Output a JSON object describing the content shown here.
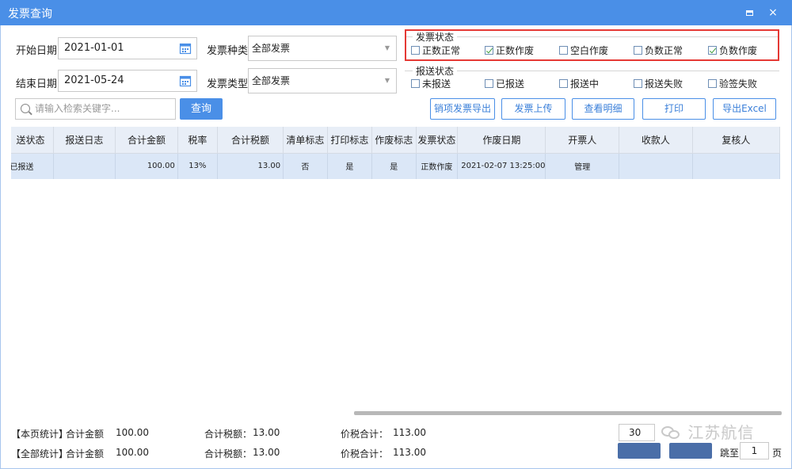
{
  "window": {
    "title": "发票查询",
    "minimize_label": "",
    "close_label": "×"
  },
  "filters": {
    "start_date_label": "开始日期",
    "start_date_value": "2021-01-01",
    "end_date_label": "结束日期",
    "end_date_value": "2021-05-24",
    "invoice_kind_label": "发票种类",
    "invoice_kind_value": "全部发票",
    "invoice_type_label": "发票类型",
    "invoice_type_value": "全部发票"
  },
  "invoice_status": {
    "title": "发票状态",
    "options": [
      {
        "label": "正数正常",
        "checked": false
      },
      {
        "label": "正数作废",
        "checked": true
      },
      {
        "label": "空白作废",
        "checked": false
      },
      {
        "label": "负数正常",
        "checked": false
      },
      {
        "label": "负数作废",
        "checked": true
      }
    ]
  },
  "report_status": {
    "title": "报送状态",
    "options": [
      {
        "label": "未报送",
        "checked": false
      },
      {
        "label": "已报送",
        "checked": false
      },
      {
        "label": "报送中",
        "checked": false
      },
      {
        "label": "报送失败",
        "checked": false
      },
      {
        "label": "验签失败",
        "checked": false
      }
    ]
  },
  "search": {
    "placeholder": "请输入检索关键字...",
    "button": "查询"
  },
  "toolbar": {
    "export_sales_items": "销项发票导出",
    "upload_invoice": "发票上传",
    "view_details": "查看明细",
    "print": "打印",
    "export_excel": "导出Excel"
  },
  "table": {
    "columns": [
      "送状态",
      "报送日志",
      "合计金额",
      "税率",
      "合计税额",
      "清单标志",
      "打印标志",
      "作废标志",
      "发票状态",
      "作废日期",
      "开票人",
      "收款人",
      "复核人"
    ],
    "rows": [
      [
        "已报送",
        "",
        "100.00",
        "13%",
        "13.00",
        "否",
        "是",
        "是",
        "正数作废",
        "2021-02-07 13:25:00",
        "管理",
        "",
        ""
      ]
    ]
  },
  "stats": {
    "page_label": "【本页统计】",
    "all_label": "【全部统计】",
    "amount_label": "合计金额",
    "tax_label": "合计税额：",
    "total_label": "价税合计：",
    "page_amount": "100.00",
    "page_tax": "13.00",
    "page_total": "113.00",
    "all_amount": "100.00",
    "all_tax": "13.00",
    "all_total": "113.00"
  },
  "pager": {
    "page_size": "30",
    "goto_label": "跳至",
    "page_number": "1",
    "page_unit": "页"
  },
  "watermark": {
    "text": "江苏航信"
  }
}
